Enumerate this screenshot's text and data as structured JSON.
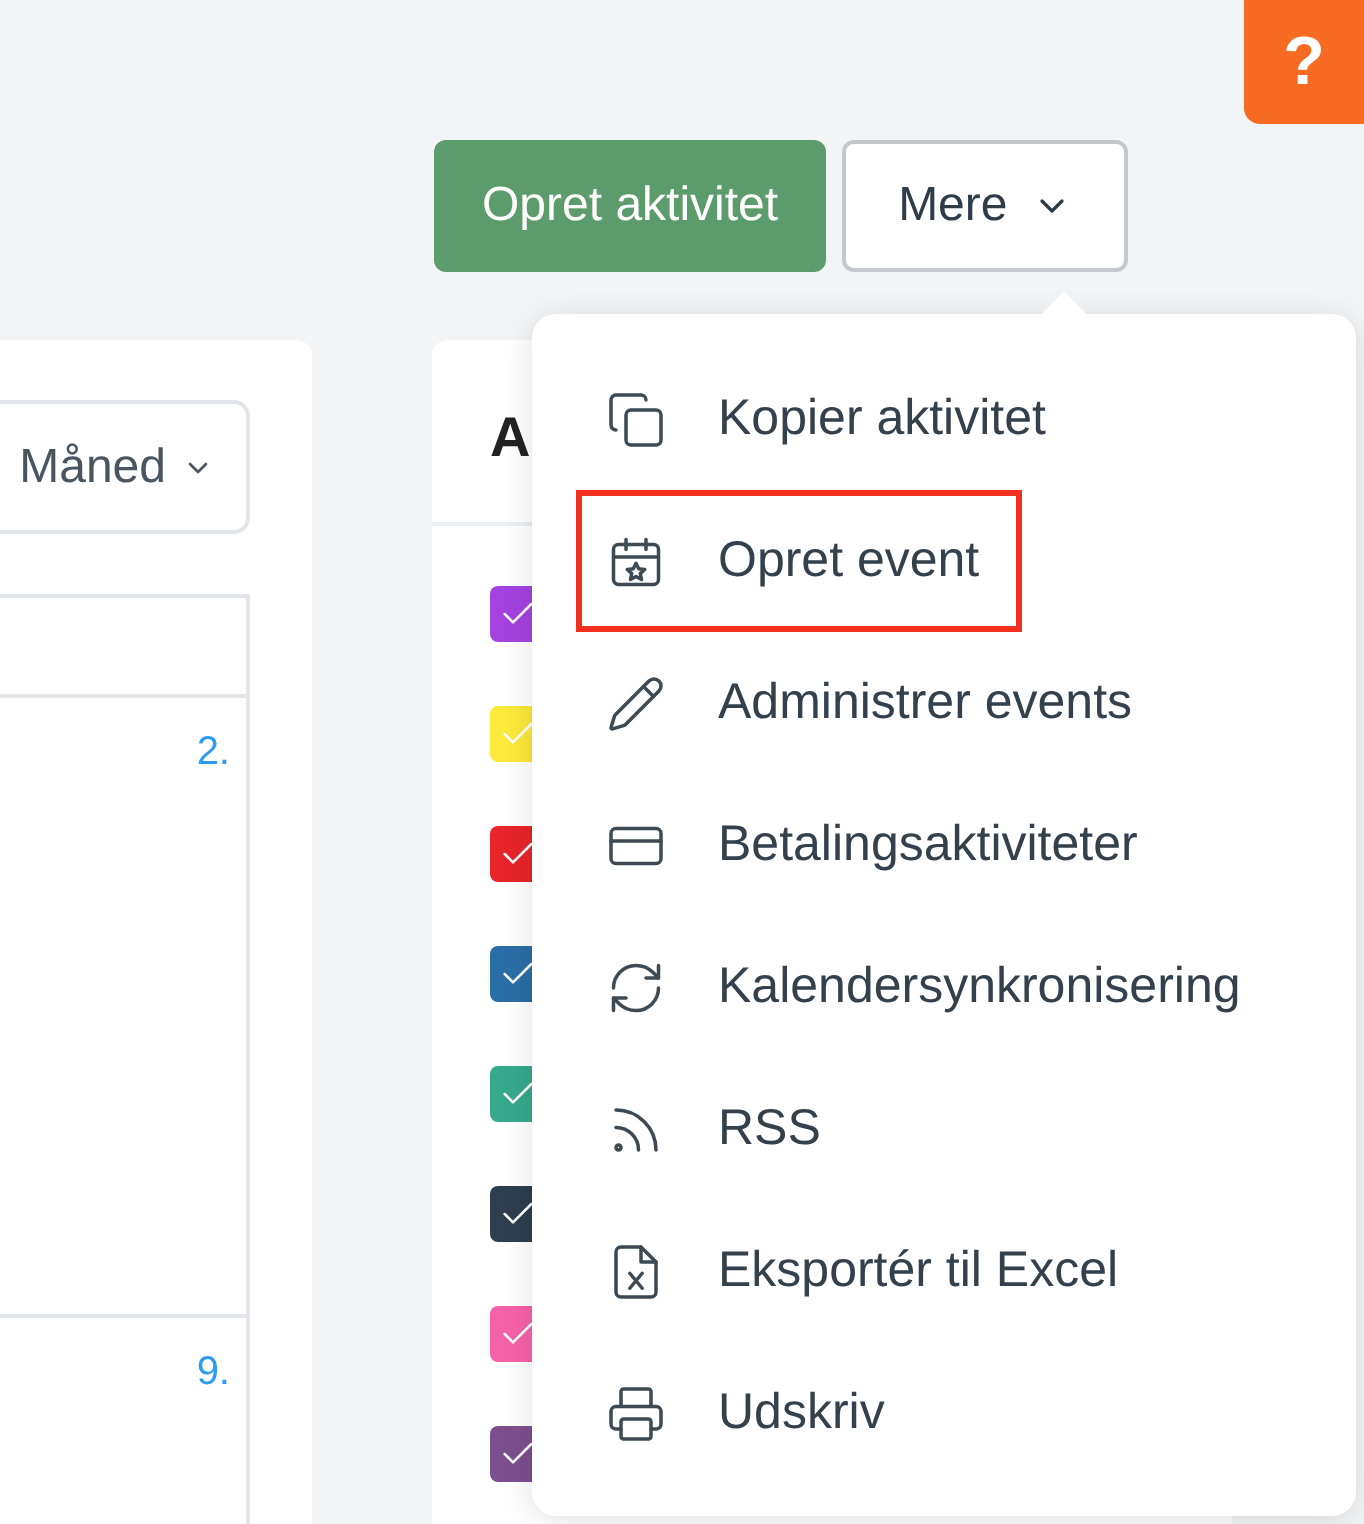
{
  "help_button": {
    "label": "?"
  },
  "actions": {
    "primary": "Opret aktivitet",
    "more": "Mere"
  },
  "calendar": {
    "view_select": "Måned",
    "day_numbers": [
      "2.",
      "9."
    ]
  },
  "activity_panel": {
    "title": "A",
    "filters": [
      {
        "color": "#a443e0",
        "checked": true
      },
      {
        "color": "#fbe93b",
        "checked": true
      },
      {
        "color": "#e7252a",
        "checked": true
      },
      {
        "color": "#2a6ea6",
        "checked": true
      },
      {
        "color": "#36a98c",
        "checked": true
      },
      {
        "color": "#2e3e4e",
        "checked": true
      },
      {
        "color": "#f662a8",
        "checked": true
      },
      {
        "color": "#7c4f8e",
        "checked": true
      }
    ]
  },
  "more_menu": {
    "items": [
      {
        "label": "Kopier aktivitet",
        "highlighted": false
      },
      {
        "label": "Opret event",
        "highlighted": true
      },
      {
        "label": "Administrer events",
        "highlighted": false
      },
      {
        "label": "Betalingsaktiviteter",
        "highlighted": false
      },
      {
        "label": "Kalendersynkronisering",
        "highlighted": false
      },
      {
        "label": "RSS",
        "highlighted": false
      },
      {
        "label": "Eksportér til Excel",
        "highlighted": false
      },
      {
        "label": "Udskriv",
        "highlighted": false
      }
    ]
  }
}
